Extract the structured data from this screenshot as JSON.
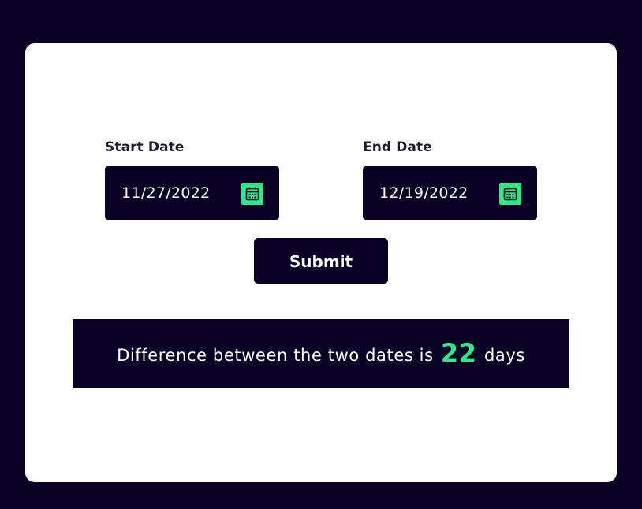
{
  "form": {
    "start": {
      "label": "Start Date",
      "value": "11/27/2022",
      "icon": "calendar-icon"
    },
    "end": {
      "label": "End Date",
      "value": "12/19/2022",
      "icon": "calendar-icon"
    },
    "submit_label": "Submit"
  },
  "result": {
    "prefix": "Difference between the two dates is",
    "value": "22",
    "suffix": "days"
  },
  "colors": {
    "background": "#0a0225",
    "card": "#ffffff",
    "accent": "#2ee88a",
    "text_light": "#ffffff",
    "label_text": "#1b1b2e"
  }
}
